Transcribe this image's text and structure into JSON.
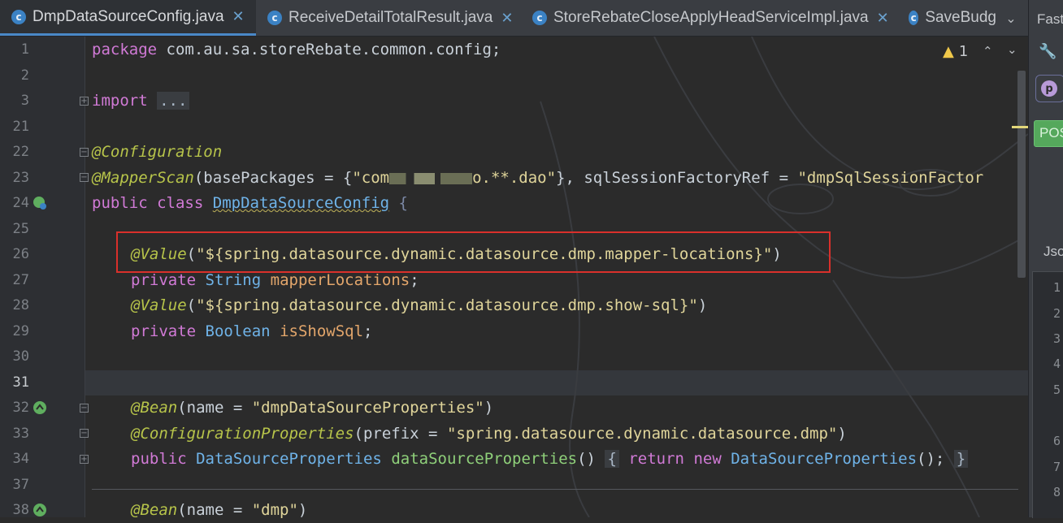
{
  "tabs": [
    {
      "label": "DmpDataSourceConfig.java",
      "icon": "java-class-icon",
      "active": true
    },
    {
      "label": "ReceiveDetailTotalResult.java",
      "icon": "java-class-icon",
      "active": false
    },
    {
      "label": "StoreRebateCloseApplyHeadServiceImpl.java",
      "icon": "java-class-icon",
      "active": false
    },
    {
      "label": "SaveBudg",
      "icon": "java-class-icon",
      "active": false
    }
  ],
  "tab_close_glyph": "✕",
  "inspections": {
    "warnings": "1"
  },
  "line_numbers": [
    "1",
    "2",
    "3",
    "21",
    "22",
    "23",
    "24",
    "25",
    "26",
    "27",
    "28",
    "29",
    "30",
    "31",
    "32",
    "33",
    "34",
    "37",
    "38"
  ],
  "current_line": "31",
  "code": {
    "l1": {
      "kw": "package",
      "rest": " com.au.sa.storeRebate.common.config;"
    },
    "l3": {
      "kw": "import",
      "dots": "..."
    },
    "l22": {
      "ann": "@Configuration"
    },
    "l23": {
      "ann": "@MapperScan",
      "p1": "(basePackages = {",
      "s1": "\"com",
      "s1b": "o.**.dao\"",
      "p2": "}, sqlSessionFactoryRef = ",
      "s2": "\"dmpSqlSessionFactor"
    },
    "l24": {
      "kw1": "public",
      "kw2": "class",
      "cls": "DmpDataSourceConfig",
      "brace": "{"
    },
    "l26": {
      "ann": "@Value",
      "s": "\"${spring.datasource.dynamic.datasource.dmp.mapper-locations}\""
    },
    "l27": {
      "kw": "private",
      "type": "String",
      "fld": "mapperLocations"
    },
    "l28": {
      "ann": "@Value",
      "s": "\"${spring.datasource.dynamic.datasource.dmp.show-sql}\""
    },
    "l29": {
      "kw": "private",
      "type": "Boolean",
      "fld": "isShowSql"
    },
    "l32": {
      "ann": "@Bean",
      "p": "(name = ",
      "s": "\"dmpDataSourceProperties\""
    },
    "l33": {
      "ann": "@ConfigurationProperties",
      "p": "(prefix = ",
      "s": "\"spring.datasource.dynamic.datasource.dmp\""
    },
    "l34": {
      "kw": "public",
      "type": "DataSourceProperties",
      "fn": "dataSourceProperties",
      "kw2": "return",
      "kw3": "new",
      "type2": "DataSourceProperties"
    },
    "l38": {
      "ann": "@Bean",
      "p": "(name = ",
      "s": "\"dmp\""
    }
  },
  "right_panel": {
    "title": "Fast",
    "method_badge": "POST",
    "p_badge": "p",
    "json_tab": "Json",
    "line_numbers": [
      "1",
      "2",
      "3",
      "4",
      "5",
      "6",
      "7",
      "8"
    ]
  },
  "colors": {
    "accent": "#4a88c7",
    "highlight_box": "#d9302b",
    "annotation": "#b7c44a",
    "string": "#e0d59a",
    "keyword": "#d17ad6"
  }
}
